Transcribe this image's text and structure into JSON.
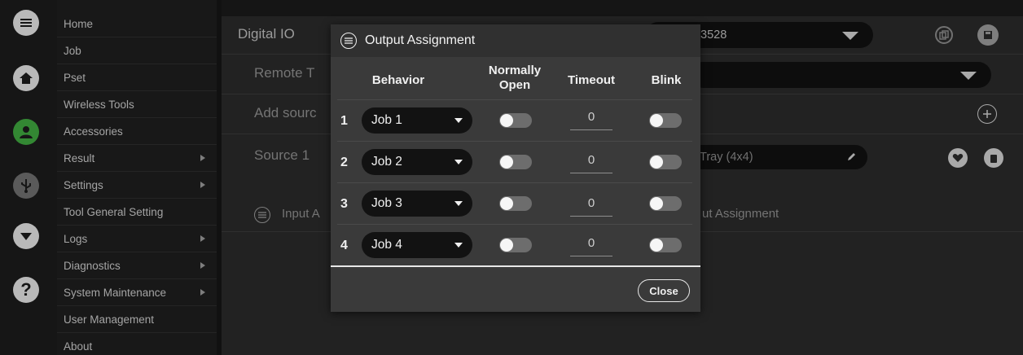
{
  "rail": {
    "icons": [
      "hamburger-menu-icon",
      "home-icon",
      "user-icon",
      "usb-icon",
      "chevron-down-circle-icon",
      "help-icon"
    ]
  },
  "menu": {
    "items": [
      {
        "label": "Home",
        "submenu": false
      },
      {
        "label": "Job",
        "submenu": false
      },
      {
        "label": "Pset",
        "submenu": false
      },
      {
        "label": "Wireless Tools",
        "submenu": false
      },
      {
        "label": "Accessories",
        "submenu": false
      },
      {
        "label": "Result",
        "submenu": true
      },
      {
        "label": "Settings",
        "submenu": true
      },
      {
        "label": "Tool General Setting",
        "submenu": false
      },
      {
        "label": "Logs",
        "submenu": true
      },
      {
        "label": "Diagnostics",
        "submenu": true
      },
      {
        "label": "System Maintenance",
        "submenu": true
      },
      {
        "label": "User Management",
        "submenu": false
      },
      {
        "label": "About",
        "submenu": false
      }
    ]
  },
  "main": {
    "digital_io_label": "Digital IO",
    "digital_io_select_value": "3528",
    "remote_label": "Remote T",
    "add_source_label": "Add sourc",
    "source1_label": "Source 1",
    "source1_select_value": "Tray (4x4)",
    "input_assignment_label": "Input A",
    "output_assignment_label": "ut Assignment"
  },
  "modal": {
    "title": "Output Assignment",
    "columns": {
      "behavior": "Behavior",
      "normally_open_line1": "Normally",
      "normally_open_line2": "Open",
      "timeout": "Timeout",
      "blink": "Blink"
    },
    "rows": [
      {
        "num": "1",
        "behavior": "Job 1",
        "normally_open": false,
        "timeout": "0",
        "blink": false
      },
      {
        "num": "2",
        "behavior": "Job 2",
        "normally_open": false,
        "timeout": "0",
        "blink": false
      },
      {
        "num": "3",
        "behavior": "Job 3",
        "normally_open": false,
        "timeout": "0",
        "blink": false
      },
      {
        "num": "4",
        "behavior": "Job 4",
        "normally_open": false,
        "timeout": "0",
        "blink": false
      }
    ],
    "close_label": "Close"
  },
  "colors": {
    "accent_green": "#3fa63f",
    "rail_icon": "#cfcfcf"
  }
}
